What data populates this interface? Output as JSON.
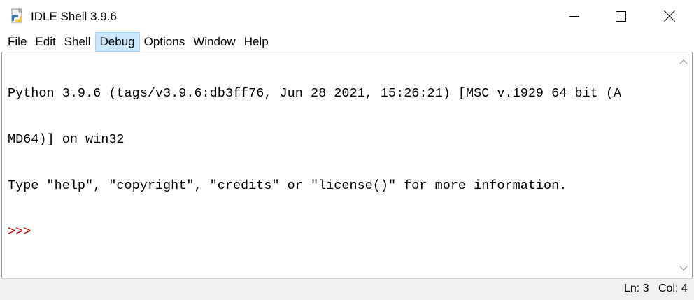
{
  "window": {
    "title": "IDLE Shell 3.9.6"
  },
  "menu": {
    "items": [
      "File",
      "Edit",
      "Shell",
      "Debug",
      "Options",
      "Window",
      "Help"
    ],
    "active": "Debug"
  },
  "shell": {
    "lines": [
      "Python 3.9.6 (tags/v3.9.6:db3ff76, Jun 28 2021, 15:26:21) [MSC v.1929 64 bit (A",
      "MD64)] on win32",
      "Type \"help\", \"copyright\", \"credits\" or \"license()\" for more information."
    ],
    "prompt": ">>>",
    "prompt_color": "#c00000"
  },
  "status": {
    "ln": "Ln: 3",
    "col": "Col: 4"
  },
  "icons": {
    "app": "python-idle-icon",
    "minimize": "minimize-icon",
    "maximize": "maximize-icon",
    "close": "close-icon",
    "scroll_up": "chevron-up-icon",
    "scroll_down": "chevron-down-icon"
  }
}
